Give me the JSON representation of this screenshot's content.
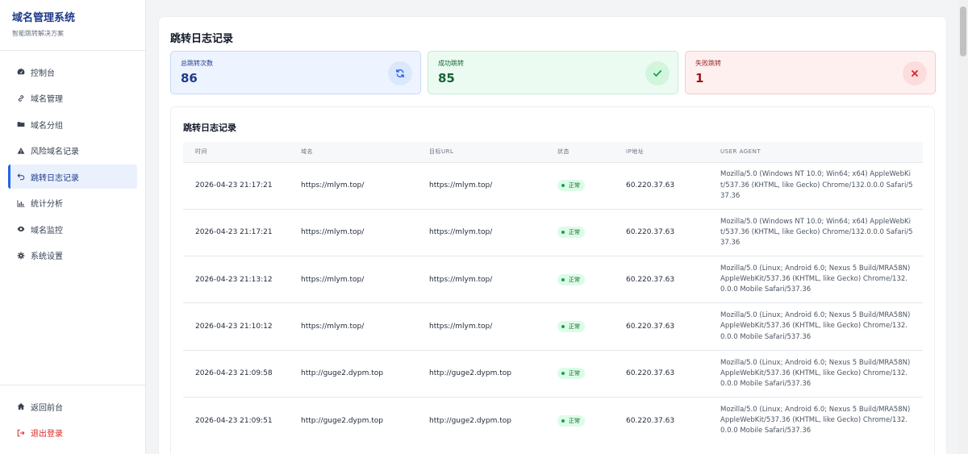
{
  "brand": {
    "title": "域名管理系统",
    "subtitle": "智能跳转解决方案"
  },
  "nav": [
    {
      "label": "控制台",
      "icon": "dashboard-icon"
    },
    {
      "label": "域名管理",
      "icon": "link-icon"
    },
    {
      "label": "域名分组",
      "icon": "folder-icon"
    },
    {
      "label": "风险域名记录",
      "icon": "warning-icon"
    },
    {
      "label": "跳转日志记录",
      "icon": "redirect-log-icon",
      "active": true
    },
    {
      "label": "统计分析",
      "icon": "bar-chart-icon"
    },
    {
      "label": "域名监控",
      "icon": "eye-icon"
    },
    {
      "label": "系统设置",
      "icon": "gear-icon"
    }
  ],
  "nav_bottom": [
    {
      "label": "返回前台",
      "icon": "home-icon"
    },
    {
      "label": "退出登录",
      "icon": "logout-icon"
    }
  ],
  "page": {
    "title": "跳转日志记录"
  },
  "stats": {
    "total": {
      "label": "总跳转次数",
      "value": "86",
      "icon": "sync-icon",
      "color": "#2563eb"
    },
    "success": {
      "label": "成功跳转",
      "value": "85",
      "icon": "check-icon",
      "color": "#16a34a"
    },
    "fail": {
      "label": "失败跳转",
      "value": "1",
      "icon": "x-icon",
      "color": "#dc2626"
    }
  },
  "log": {
    "title": "跳转日志记录",
    "columns": [
      "时间",
      "域名",
      "目标URL",
      "状态",
      "IP地址",
      "USER AGENT"
    ],
    "rows": [
      {
        "time": "2026-04-23 21:17:21",
        "domain": "https://mlym.top/",
        "target": "https://mlym.top/",
        "status": "正常",
        "ip": "60.220.37.63",
        "ua": "Mozilla/5.0 (Windows NT 10.0; Win64; x64) AppleWebKit/537.36 (KHTML, like Gecko) Chrome/132.0.0.0 Safari/537.36"
      },
      {
        "time": "2026-04-23 21:17:21",
        "domain": "https://mlym.top/",
        "target": "https://mlym.top/",
        "status": "正常",
        "ip": "60.220.37.63",
        "ua": "Mozilla/5.0 (Windows NT 10.0; Win64; x64) AppleWebKit/537.36 (KHTML, like Gecko) Chrome/132.0.0.0 Safari/537.36"
      },
      {
        "time": "2026-04-23 21:13:12",
        "domain": "https://mlym.top/",
        "target": "https://mlym.top/",
        "status": "正常",
        "ip": "60.220.37.63",
        "ua": "Mozilla/5.0 (Linux; Android 6.0; Nexus 5 Build/MRA58N) AppleWebKit/537.36 (KHTML, like Gecko) Chrome/132.0.0.0 Mobile Safari/537.36"
      },
      {
        "time": "2026-04-23 21:10:12",
        "domain": "https://mlym.top/",
        "target": "https://mlym.top/",
        "status": "正常",
        "ip": "60.220.37.63",
        "ua": "Mozilla/5.0 (Linux; Android 6.0; Nexus 5 Build/MRA58N) AppleWebKit/537.36 (KHTML, like Gecko) Chrome/132.0.0.0 Mobile Safari/537.36"
      },
      {
        "time": "2026-04-23 21:09:58",
        "domain": "http://guge2.dypm.top",
        "target": "http://guge2.dypm.top",
        "status": "正常",
        "ip": "60.220.37.63",
        "ua": "Mozilla/5.0 (Linux; Android 6.0; Nexus 5 Build/MRA58N) AppleWebKit/537.36 (KHTML, like Gecko) Chrome/132.0.0.0 Mobile Safari/537.36"
      },
      {
        "time": "2026-04-23 21:09:51",
        "domain": "http://guge2.dypm.top",
        "target": "http://guge2.dypm.top",
        "status": "正常",
        "ip": "60.220.37.63",
        "ua": "Mozilla/5.0 (Linux; Android 6.0; Nexus 5 Build/MRA58N) AppleWebKit/537.36 (KHTML, like Gecko) Chrome/132.0.0.0 Mobile Safari/537.36"
      }
    ]
  }
}
